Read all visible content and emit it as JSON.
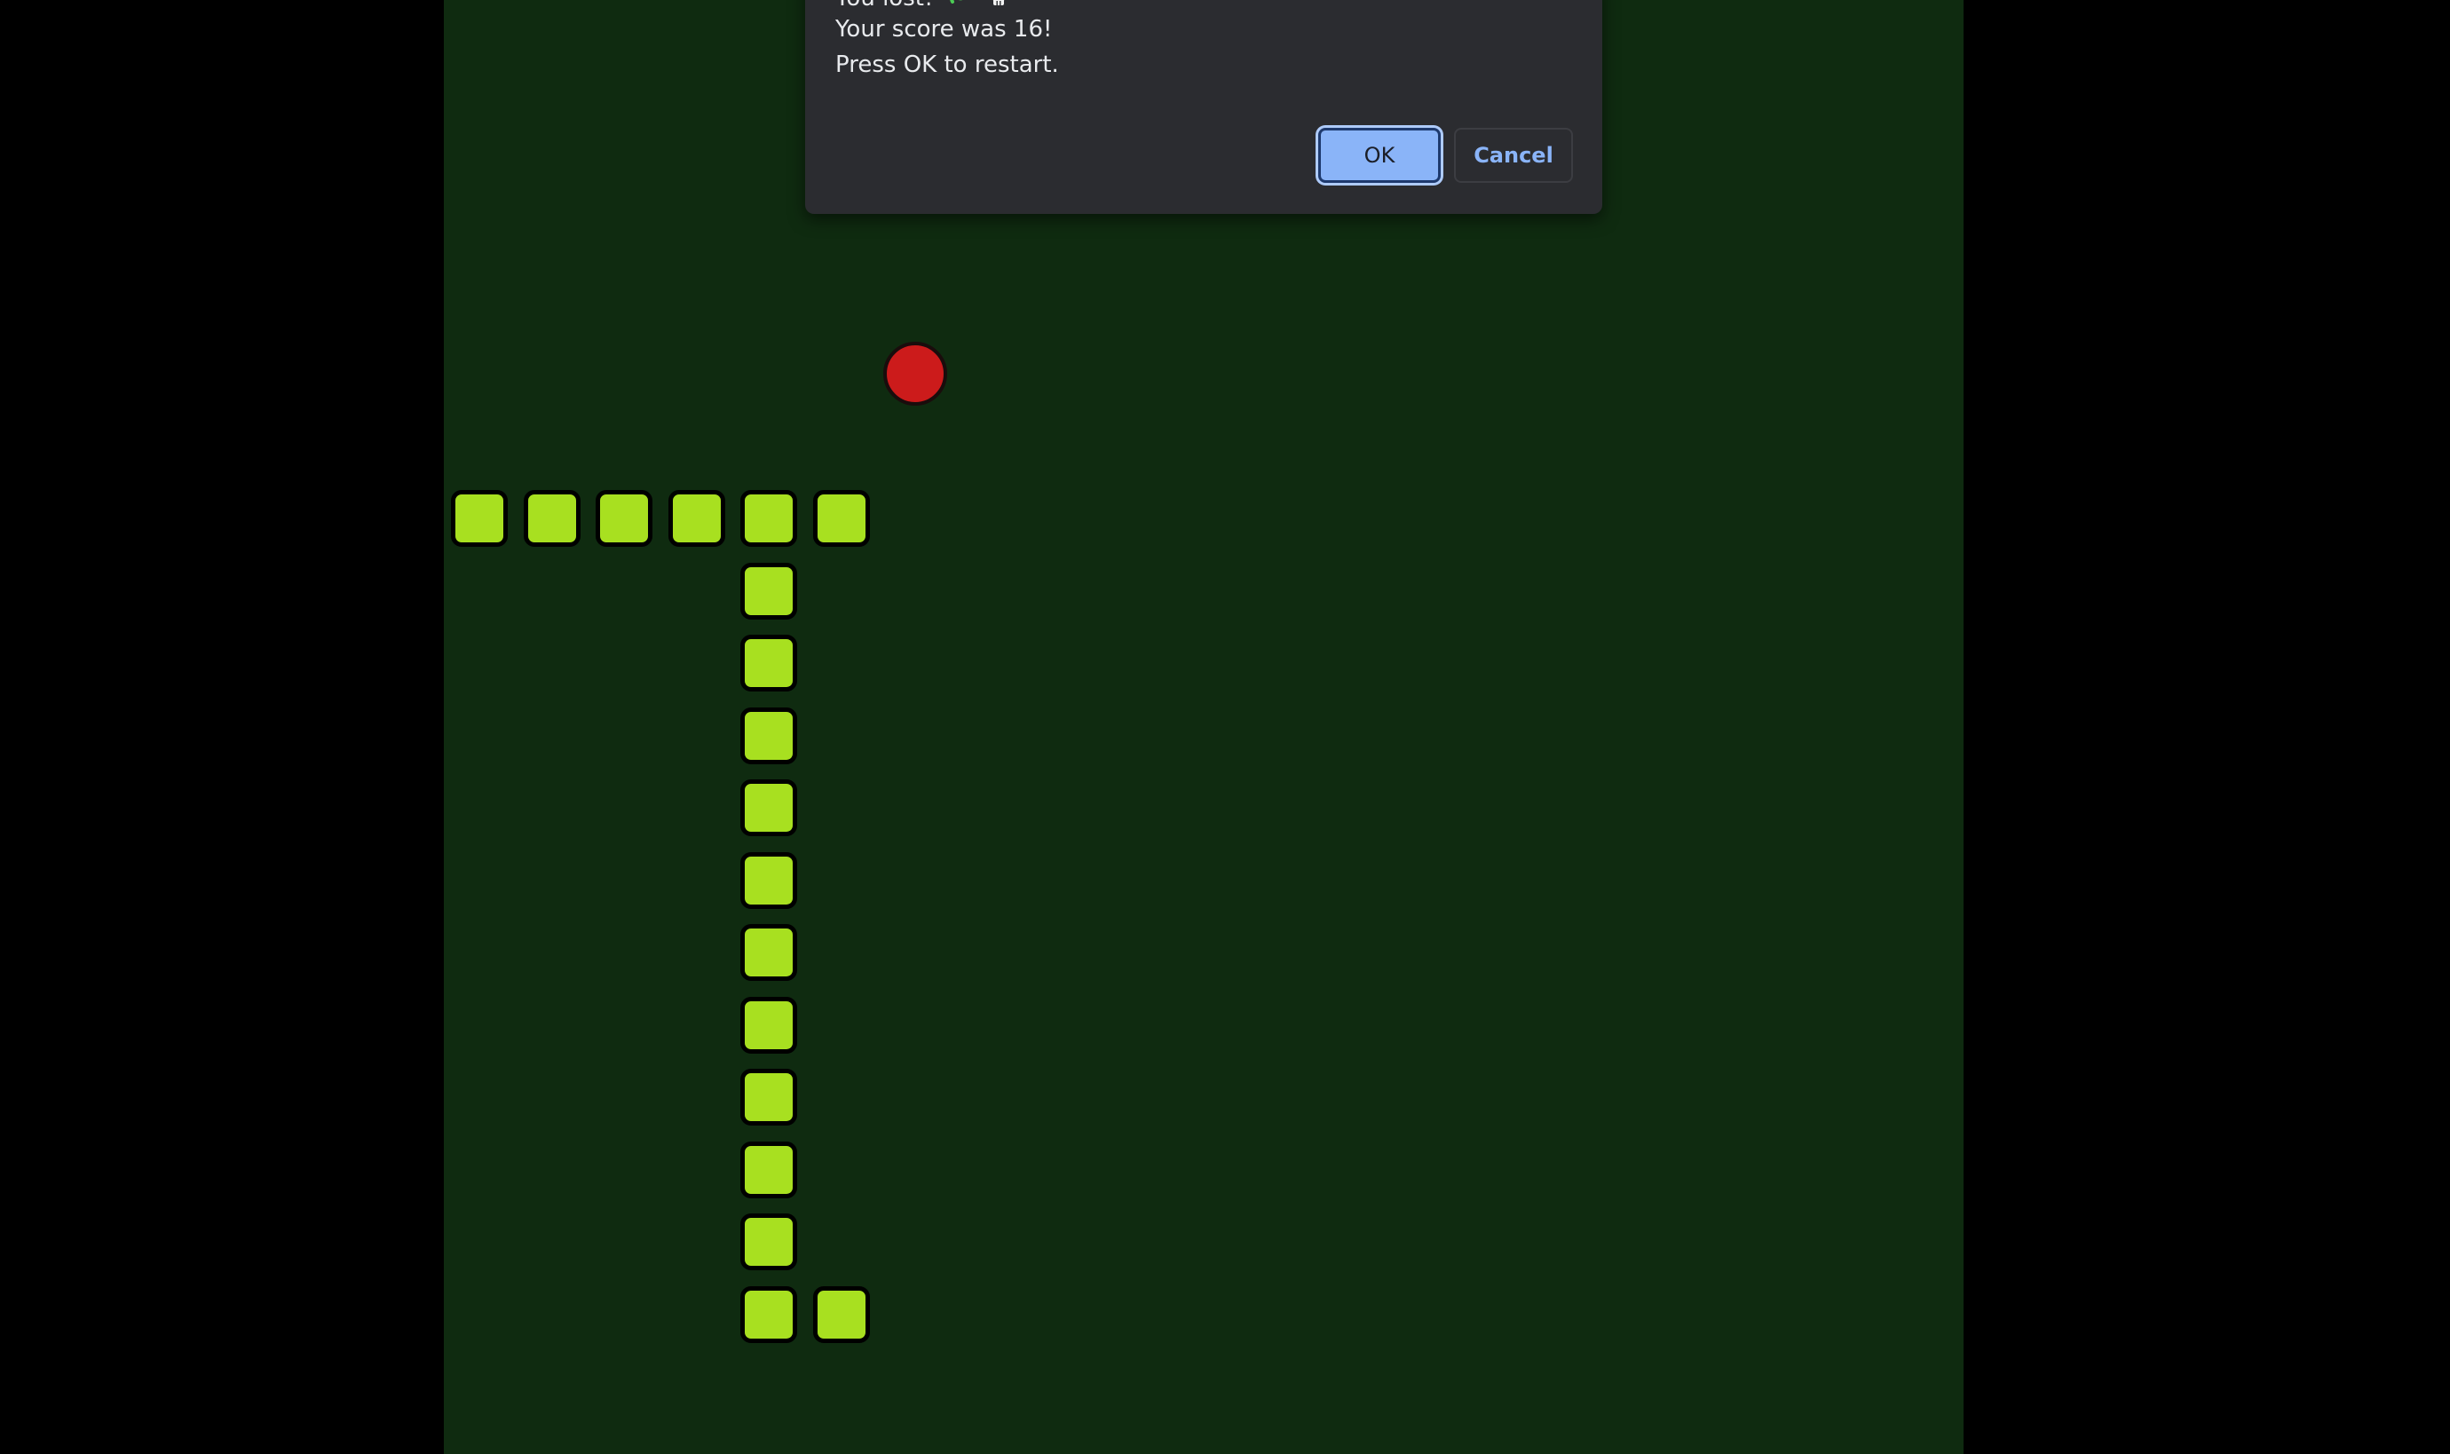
{
  "game": {
    "board_color": "#0f2b10",
    "snake_color": "#a8e020",
    "food_color": "#cc1b1b",
    "snake_length": 18,
    "snake_segments": [
      {
        "col": 0,
        "row": 0
      },
      {
        "col": 1,
        "row": 0
      },
      {
        "col": 2,
        "row": 0
      },
      {
        "col": 3,
        "row": 0
      },
      {
        "col": 4,
        "row": 0
      },
      {
        "col": 5,
        "row": 0
      },
      {
        "col": 4,
        "row": 1
      },
      {
        "col": 4,
        "row": 2
      },
      {
        "col": 4,
        "row": 3
      },
      {
        "col": 4,
        "row": 4
      },
      {
        "col": 4,
        "row": 5
      },
      {
        "col": 4,
        "row": 6
      },
      {
        "col": 4,
        "row": 7
      },
      {
        "col": 4,
        "row": 8
      },
      {
        "col": 4,
        "row": 9
      },
      {
        "col": 4,
        "row": 10
      },
      {
        "col": 4,
        "row": 11
      },
      {
        "col": 5,
        "row": 11
      }
    ],
    "food": {
      "col": 6,
      "row": -2
    }
  },
  "dialog": {
    "line1_text": "You lost!",
    "line1_icons": [
      "snake-icon",
      "skull-icon"
    ],
    "line2_text": "Your score was 16!",
    "line3_text": "Press OK to restart.",
    "ok_label": "OK",
    "cancel_label": "Cancel",
    "accent_color": "#8ab4f8"
  }
}
